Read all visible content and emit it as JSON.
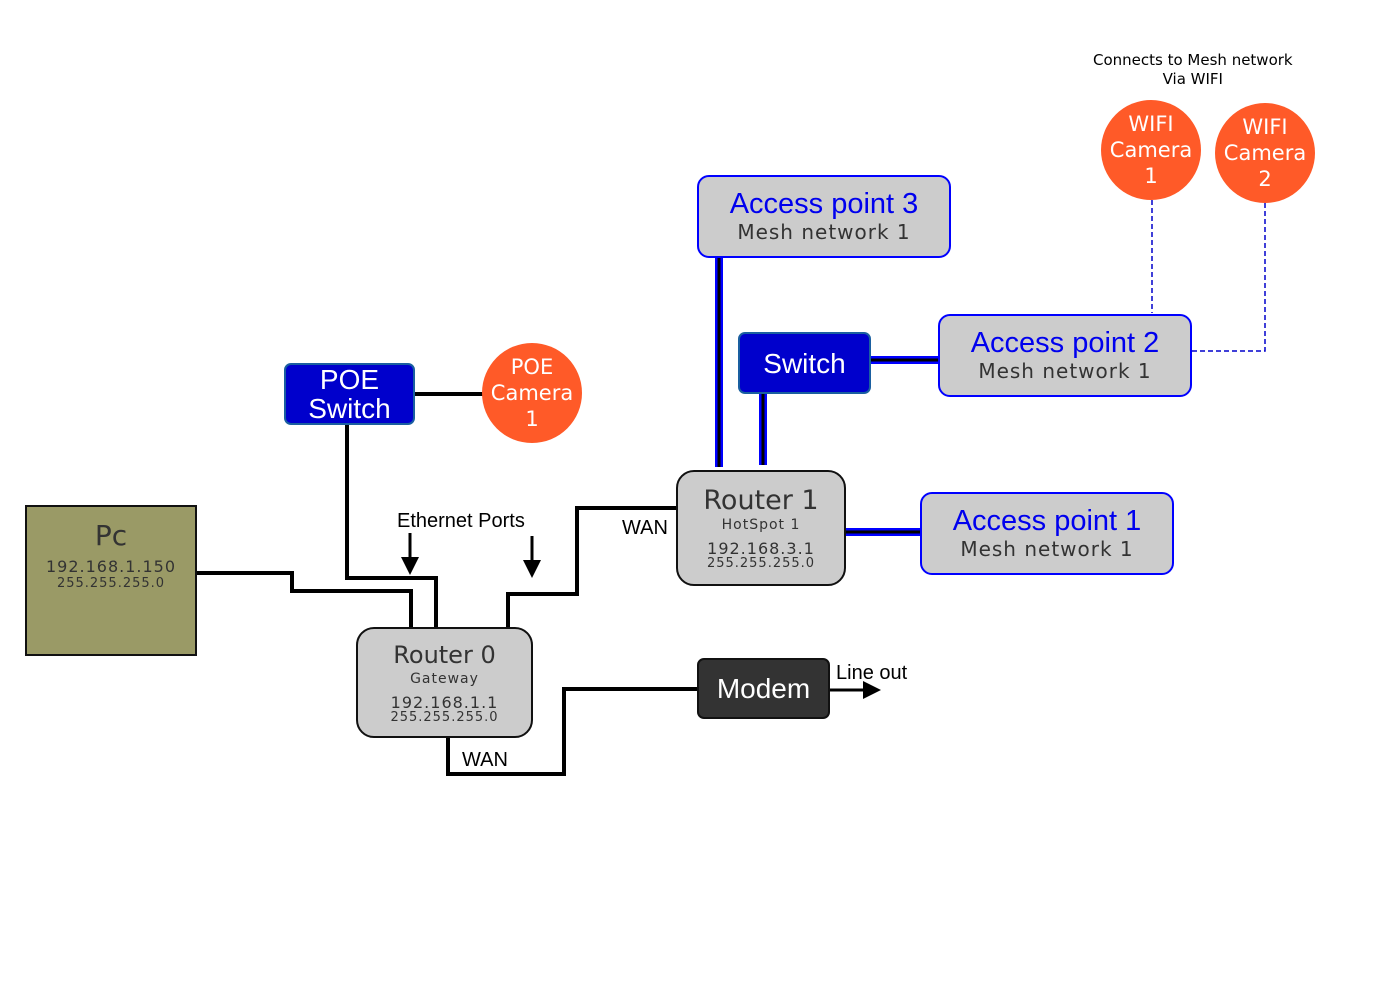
{
  "colors": {
    "access_point_border": "#0000ff",
    "access_point_text": "#0000ee",
    "switch_fill": "#0000cc",
    "camera_fill": "#ff5a28",
    "device_fill": "#cccccc",
    "pc_fill": "#9a9a66",
    "modem_fill": "#333333"
  },
  "note": {
    "line1": "Connects to Mesh network",
    "line2": "Via WIFI"
  },
  "pc": {
    "title": "Pc",
    "ip": "192.168.1.150",
    "mask": "255.255.255.0"
  },
  "poe_switch": {
    "line1": "POE",
    "line2": "Switch"
  },
  "poe_camera": {
    "line1": "POE",
    "line2": "Camera",
    "line3": "1"
  },
  "wifi_camera_1": {
    "line1": "WIFI",
    "line2": "Camera",
    "line3": "1"
  },
  "wifi_camera_2": {
    "line1": "WIFI",
    "line2": "Camera",
    "line3": "2"
  },
  "access_point_3": {
    "title": "Access point 3",
    "subtitle": "Mesh network 1"
  },
  "access_point_2": {
    "title": "Access point 2",
    "subtitle": "Mesh network 1"
  },
  "access_point_1": {
    "title": "Access point 1",
    "subtitle": "Mesh network 1"
  },
  "switch": {
    "label": "Switch"
  },
  "router_1": {
    "title": "Router 1",
    "subtitle": "HotSpot 1",
    "ip": "192.168.3.1",
    "mask": "255.255.255.0"
  },
  "router_0": {
    "title": "Router 0",
    "subtitle": "Gateway",
    "ip": "192.168.1.1",
    "mask": "255.255.255.0"
  },
  "modem": {
    "label": "Modem"
  },
  "labels": {
    "ethernet_ports": "Ethernet Ports",
    "wan_router1": "WAN",
    "wan_router0": "WAN",
    "line_out": "Line out"
  }
}
